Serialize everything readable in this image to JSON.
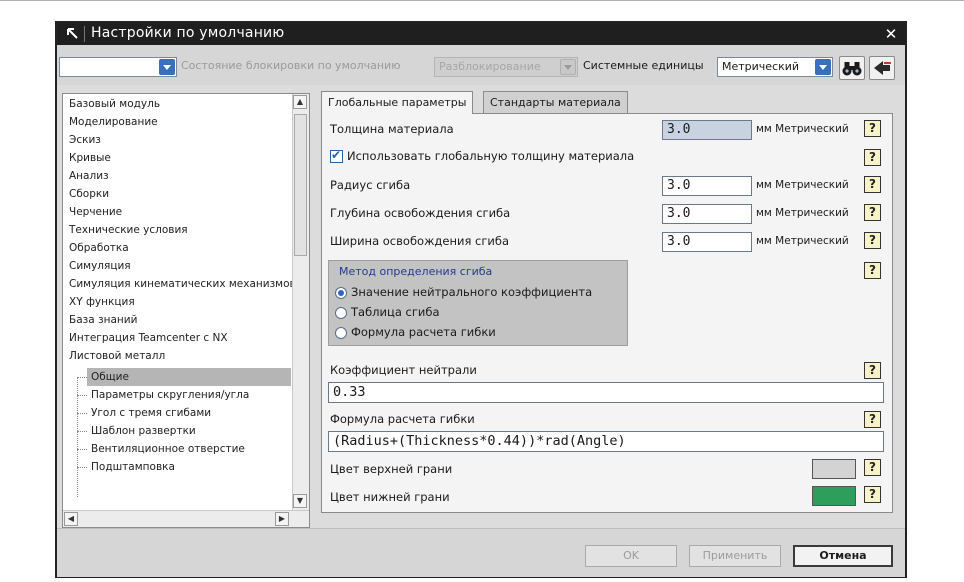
{
  "window": {
    "title": "Настройки по умолчанию",
    "close_glyph": "✕"
  },
  "toolbar": {
    "level_combo_value": "",
    "lock_state_label": "Состояние блокировки по умолчанию",
    "lock_state_value": "Разблокирование",
    "units_label": "Системные единицы",
    "units_value": "Метрический",
    "find_icon": "binoculars-icon",
    "import_icon": "import-arrow-icon"
  },
  "tree": {
    "items": [
      "Базовый модуль",
      "Моделирование",
      "Эскиз",
      "Кривые",
      "Анализ",
      "Сборки",
      "Черчение",
      "Технические условия",
      "Обработка",
      "Симуляция",
      "Симуляция кинематических механизмов",
      "XY функция",
      "База знаний",
      "Интеграция Teamcenter с NX",
      "Листовой металл"
    ],
    "children": [
      "Общие",
      "Параметры скругления/угла",
      "Угол с тремя сгибами",
      "Шаблон развертки",
      "Вентиляционное отверстие",
      "Подштамповка"
    ],
    "selected": "Общие"
  },
  "tabs": [
    {
      "label": "Глобальные параметры",
      "active": true
    },
    {
      "label": "Стандарты материала",
      "active": false
    }
  ],
  "params": {
    "thickness_label": "Толщина материала",
    "thickness_value": "3.0",
    "thickness_unit": "мм Метрический",
    "use_global_label": "Использовать глобальную толщину материала",
    "use_global_checked": true,
    "bend_radius_label": "Радиус сгиба",
    "bend_radius_value": "3.0",
    "bend_radius_unit": "мм Метрический",
    "relief_depth_label": "Глубина освобождения сгиба",
    "relief_depth_value": "3.0",
    "relief_depth_unit": "мм Метрический",
    "relief_width_label": "Ширина освобождения сгиба",
    "relief_width_value": "3.0",
    "relief_width_unit": "мм Метрический",
    "help_glyph": "?"
  },
  "bend_method": {
    "title": "Метод определения сгиба",
    "options": [
      "Значение нейтрального коэффициента",
      "Таблица сгиба",
      "Формула расчета гибки"
    ],
    "selected": "Значение нейтрального коэффициента"
  },
  "neutral": {
    "label": "Коэффициент нейтрали",
    "value": "0.33"
  },
  "formula": {
    "label": "Формула расчета гибки",
    "value": "(Radius+(Thickness*0.44))*rad(Angle)"
  },
  "colors": {
    "top_face_label": "Цвет верхней грани",
    "top_face_color": "#d3d3d3",
    "bottom_face_label": "Цвет нижней грани",
    "bottom_face_color": "#2e9e5c"
  },
  "buttons": {
    "ok": "OK",
    "apply": "Применить",
    "cancel": "Отмена"
  }
}
